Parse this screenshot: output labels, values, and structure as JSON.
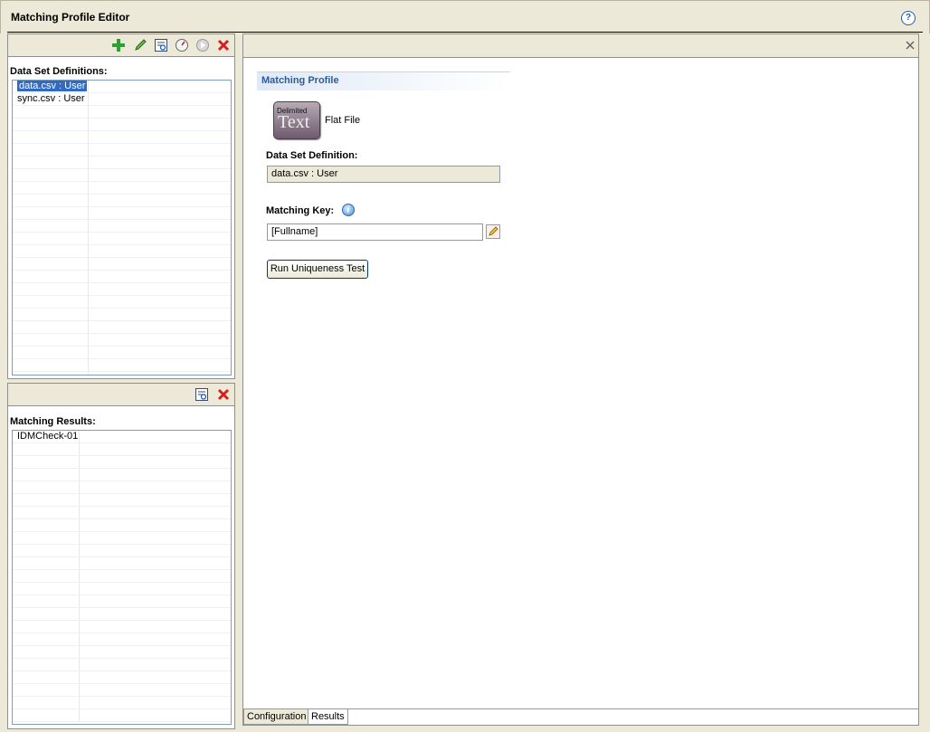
{
  "window": {
    "title": "Matching Profile Editor"
  },
  "icons": {
    "help": "?",
    "add": "plus-icon",
    "edit": "pencil-icon",
    "view": "view-details-icon",
    "settings": "gauge-icon",
    "run": "play-icon",
    "delete": "red-x-icon",
    "close": "close-icon",
    "info": "i",
    "edit_key": "pencil-icon"
  },
  "left": {
    "definitions_label": "Data Set Definitions:",
    "definitions": [
      "data.csv : User",
      "sync.csv : User"
    ],
    "results_label": "Matching Results:",
    "results": [
      "IDMCheck-01"
    ]
  },
  "right": {
    "section_title": "Matching Profile",
    "file_icon_small_text": "Delimited",
    "file_icon_big_text": "Text",
    "file_type": "Flat File",
    "dataset_label": "Data Set Definition:",
    "dataset_value": "data.csv : User",
    "key_label": "Matching Key:",
    "key_value": "[Fullname]",
    "run_button": "Run Uniqueness Test",
    "tabs": [
      "Configuration",
      "Results"
    ]
  },
  "colors": {
    "selection": "#316ac5",
    "section_title": "#2d5b9a",
    "delete": "#d42020",
    "add": "#2ea02e"
  }
}
